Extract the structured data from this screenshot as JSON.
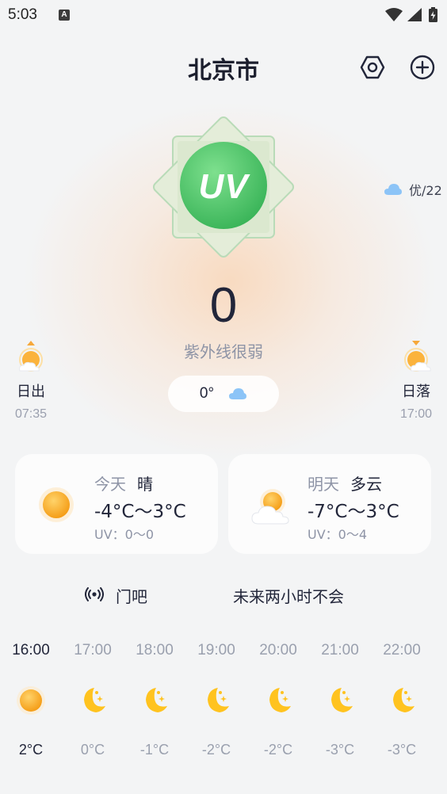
{
  "status_bar": {
    "time": "5:03",
    "notification_icon": "A",
    "icons": [
      "wifi-icon",
      "signal-icon",
      "battery-icon"
    ]
  },
  "header": {
    "title": "北京市",
    "actions": [
      "settings-hexagon-icon",
      "add-circle-icon"
    ]
  },
  "uv": {
    "badge_text": "UV",
    "value": "0",
    "description": "紫外线很弱"
  },
  "aqi": {
    "icon": "cloud-icon",
    "text": "优/22"
  },
  "current_temp": {
    "value": "0°",
    "icon": "cloud-icon"
  },
  "sunrise": {
    "label": "日出",
    "time": "07:35"
  },
  "sunset": {
    "label": "日落",
    "time": "17:00"
  },
  "forecast": [
    {
      "day": "今天",
      "weather": "晴",
      "temp": "-4°C〜3°C",
      "uv": "UV：0〜0",
      "icon": "sun-icon"
    },
    {
      "day": "明天",
      "weather": "多云",
      "temp": "-7°C〜3°C",
      "uv": "UV：0〜4",
      "icon": "partly-cloudy-icon"
    }
  ],
  "ticker": {
    "icon": "radio-broadcast-icon",
    "text_left": "门吧",
    "text_right": "未来两小时不会"
  },
  "hourly": [
    {
      "time": "16:00",
      "temp": "2°C",
      "icon": "sun-icon",
      "current": true
    },
    {
      "time": "17:00",
      "temp": "0°C",
      "icon": "moon-icon"
    },
    {
      "time": "18:00",
      "temp": "-1°C",
      "icon": "moon-icon"
    },
    {
      "time": "19:00",
      "temp": "-2°C",
      "icon": "moon-icon"
    },
    {
      "time": "20:00",
      "temp": "-2°C",
      "icon": "moon-icon"
    },
    {
      "time": "21:00",
      "temp": "-3°C",
      "icon": "moon-icon"
    },
    {
      "time": "22:00",
      "temp": "-3°C",
      "icon": "moon-icon"
    }
  ],
  "colors": {
    "uv_green": "#4cc46a",
    "sun_orange": "#f9a51e",
    "moon_yellow": "#ffc31f",
    "cloud_blue": "#7ab8f5"
  }
}
